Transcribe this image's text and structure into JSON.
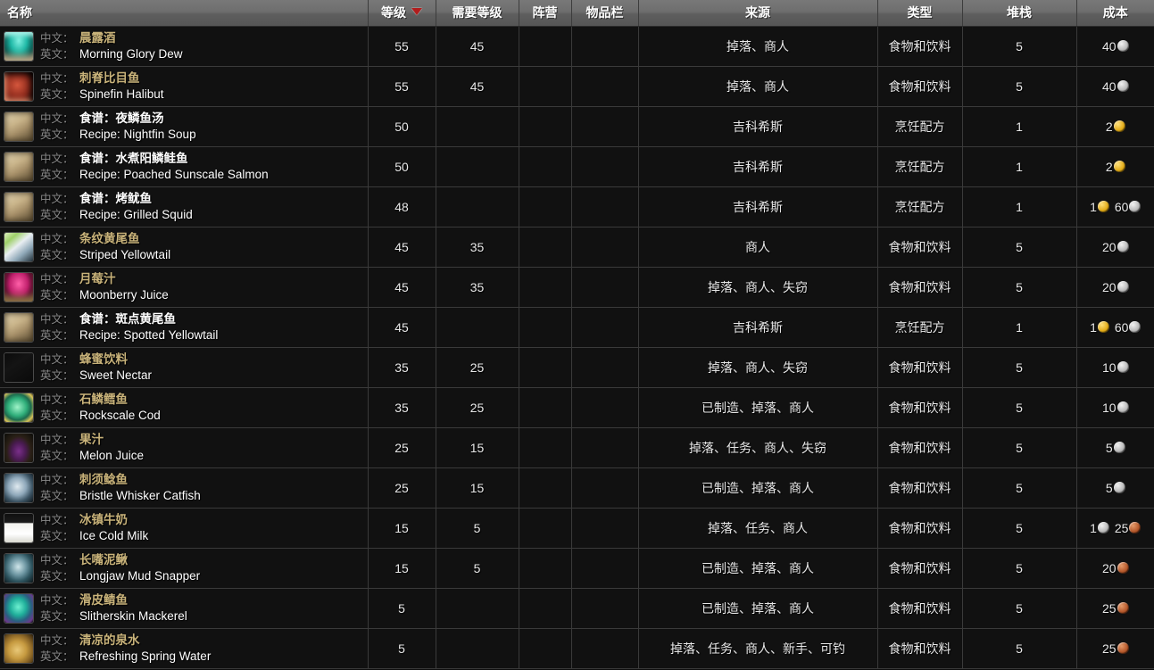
{
  "table": {
    "columns": [
      {
        "key": "name",
        "label": "名称",
        "align": "left",
        "sorted": false
      },
      {
        "key": "level",
        "label": "等级",
        "align": "center",
        "sorted": true
      },
      {
        "key": "reqlvl",
        "label": "需要等级",
        "align": "center",
        "sorted": false
      },
      {
        "key": "faction",
        "label": "阵营",
        "align": "center",
        "sorted": false
      },
      {
        "key": "slot",
        "label": "物品栏",
        "align": "center",
        "sorted": false
      },
      {
        "key": "source",
        "label": "来源",
        "align": "center",
        "sorted": false
      },
      {
        "key": "type",
        "label": "类型",
        "align": "center",
        "sorted": false
      },
      {
        "key": "stack",
        "label": "堆栈",
        "align": "center",
        "sorted": false
      },
      {
        "key": "cost",
        "label": "成本",
        "align": "center",
        "sorted": false
      }
    ],
    "labels": {
      "cn": "中文：",
      "en": "英文："
    },
    "rows": [
      {
        "icon": "potion-green-bowl-icon",
        "icon_kind": "drink-teal",
        "quality": "uncommon",
        "name_cn": "晨露酒",
        "name_en": "Morning Glory Dew",
        "level": "55",
        "reqlvl": "45",
        "faction": "",
        "slot": "",
        "source": "掉落、商人",
        "type": "食物和饮料",
        "stack": "5",
        "cost": [
          {
            "amount": "40",
            "coin": "silver"
          }
        ]
      },
      {
        "icon": "fish-red-icon",
        "icon_kind": "fish-red",
        "quality": "uncommon",
        "name_cn": "刺脊比目鱼",
        "name_en": "Spinefin Halibut",
        "level": "55",
        "reqlvl": "45",
        "faction": "",
        "slot": "",
        "source": "掉落、商人",
        "type": "食物和饮料",
        "stack": "5",
        "cost": [
          {
            "amount": "40",
            "coin": "silver"
          }
        ]
      },
      {
        "icon": "scroll-recipe-icon",
        "icon_kind": "scroll",
        "quality": "common",
        "name_cn": "食谱：夜鳞鱼汤",
        "name_en": "Recipe: Nightfin Soup",
        "level": "50",
        "reqlvl": "",
        "faction": "",
        "slot": "",
        "source": "吉科希斯",
        "type": "烹饪配方",
        "stack": "1",
        "cost": [
          {
            "amount": "2",
            "coin": "gold"
          }
        ]
      },
      {
        "icon": "scroll-recipe-icon",
        "icon_kind": "scroll",
        "quality": "common",
        "name_cn": "食谱：水煮阳鳞鲑鱼",
        "name_en": "Recipe: Poached Sunscale Salmon",
        "level": "50",
        "reqlvl": "",
        "faction": "",
        "slot": "",
        "source": "吉科希斯",
        "type": "烹饪配方",
        "stack": "1",
        "cost": [
          {
            "amount": "2",
            "coin": "gold"
          }
        ]
      },
      {
        "icon": "scroll-recipe-icon",
        "icon_kind": "scroll",
        "quality": "common",
        "name_cn": "食谱：烤鱿鱼",
        "name_en": "Recipe: Grilled Squid",
        "level": "48",
        "reqlvl": "",
        "faction": "",
        "slot": "",
        "source": "吉科希斯",
        "type": "烹饪配方",
        "stack": "1",
        "cost": [
          {
            "amount": "1",
            "coin": "gold"
          },
          {
            "amount": "60",
            "coin": "silver"
          }
        ]
      },
      {
        "icon": "fish-yellowtail-icon",
        "icon_kind": "fish-striped",
        "quality": "uncommon",
        "name_cn": "条纹黄尾鱼",
        "name_en": "Striped Yellowtail",
        "level": "45",
        "reqlvl": "35",
        "faction": "",
        "slot": "",
        "source": "商人",
        "type": "食物和饮料",
        "stack": "5",
        "cost": [
          {
            "amount": "20",
            "coin": "silver"
          }
        ]
      },
      {
        "icon": "juice-pink-icon",
        "icon_kind": "drink-pink",
        "quality": "uncommon",
        "name_cn": "月莓汁",
        "name_en": "Moonberry Juice",
        "level": "45",
        "reqlvl": "35",
        "faction": "",
        "slot": "",
        "source": "掉落、商人、失窃",
        "type": "食物和饮料",
        "stack": "5",
        "cost": [
          {
            "amount": "20",
            "coin": "silver"
          }
        ]
      },
      {
        "icon": "scroll-recipe-icon",
        "icon_kind": "scroll",
        "quality": "common",
        "name_cn": "食谱：斑点黄尾鱼",
        "name_en": "Recipe: Spotted Yellowtail",
        "level": "45",
        "reqlvl": "",
        "faction": "",
        "slot": "",
        "source": "吉科希斯",
        "type": "烹饪配方",
        "stack": "1",
        "cost": [
          {
            "amount": "1",
            "coin": "gold"
          },
          {
            "amount": "60",
            "coin": "silver"
          }
        ]
      },
      {
        "icon": "bottle-white-icon",
        "icon_kind": "bottle-white",
        "quality": "uncommon",
        "name_cn": "蜂蜜饮料",
        "name_en": "Sweet Nectar",
        "level": "35",
        "reqlvl": "25",
        "faction": "",
        "slot": "",
        "source": "掉落、商人、失窃",
        "type": "食物和饮料",
        "stack": "5",
        "cost": [
          {
            "amount": "10",
            "coin": "silver"
          }
        ]
      },
      {
        "icon": "fish-green-icon",
        "icon_kind": "fish-green",
        "quality": "uncommon",
        "name_cn": "石鳞鳕鱼",
        "name_en": "Rockscale Cod",
        "level": "35",
        "reqlvl": "25",
        "faction": "",
        "slot": "",
        "source": "已制造、掉落、商人",
        "type": "食物和饮料",
        "stack": "5",
        "cost": [
          {
            "amount": "10",
            "coin": "silver"
          }
        ]
      },
      {
        "icon": "flask-purple-icon",
        "icon_kind": "flask-purple",
        "quality": "uncommon",
        "name_cn": "果汁",
        "name_en": "Melon Juice",
        "level": "25",
        "reqlvl": "15",
        "faction": "",
        "slot": "",
        "source": "掉落、任务、商人、失窃",
        "type": "食物和饮料",
        "stack": "5",
        "cost": [
          {
            "amount": "5",
            "coin": "silver"
          }
        ]
      },
      {
        "icon": "fish-blue-icon",
        "icon_kind": "fish-blue",
        "quality": "uncommon",
        "name_cn": "刺须鲶鱼",
        "name_en": "Bristle Whisker Catfish",
        "level": "25",
        "reqlvl": "15",
        "faction": "",
        "slot": "",
        "source": "已制造、掉落、商人",
        "type": "食物和饮料",
        "stack": "5",
        "cost": [
          {
            "amount": "5",
            "coin": "silver"
          }
        ]
      },
      {
        "icon": "milk-glass-icon",
        "icon_kind": "milk",
        "quality": "uncommon",
        "name_cn": "冰镇牛奶",
        "name_en": "Ice Cold Milk",
        "level": "15",
        "reqlvl": "5",
        "faction": "",
        "slot": "",
        "source": "掉落、任务、商人",
        "type": "食物和饮料",
        "stack": "5",
        "cost": [
          {
            "amount": "1",
            "coin": "silver"
          },
          {
            "amount": "25",
            "coin": "copper"
          }
        ]
      },
      {
        "icon": "fish-snapper-icon",
        "icon_kind": "fish-snapper",
        "quality": "uncommon",
        "name_cn": "长嘴泥鳅",
        "name_en": "Longjaw Mud Snapper",
        "level": "15",
        "reqlvl": "5",
        "faction": "",
        "slot": "",
        "source": "已制造、掉落、商人",
        "type": "食物和饮料",
        "stack": "5",
        "cost": [
          {
            "amount": "20",
            "coin": "copper"
          }
        ]
      },
      {
        "icon": "fish-mackerel-icon",
        "icon_kind": "fish-mackerel",
        "quality": "uncommon",
        "name_cn": "滑皮鲭鱼",
        "name_en": "Slitherskin Mackerel",
        "level": "5",
        "reqlvl": "",
        "faction": "",
        "slot": "",
        "source": "已制造、掉落、商人",
        "type": "食物和饮料",
        "stack": "5",
        "cost": [
          {
            "amount": "25",
            "coin": "copper"
          }
        ]
      },
      {
        "icon": "waterskin-icon",
        "icon_kind": "waterskin",
        "quality": "uncommon",
        "name_cn": "清凉的泉水",
        "name_en": "Refreshing Spring Water",
        "level": "5",
        "reqlvl": "",
        "faction": "",
        "slot": "",
        "source": "掉落、任务、商人、新手、可钓",
        "type": "食物和饮料",
        "stack": "5",
        "cost": [
          {
            "amount": "25",
            "coin": "copper"
          }
        ]
      }
    ]
  },
  "colors": {
    "header_bg": "#6e6e6e",
    "row_bg": "#111111",
    "grid": "#3a3a3a",
    "quality_uncommon": "#c9b37a",
    "quality_common": "#ffffff",
    "sort_caret": "#b11d1d",
    "gold": "#e3ac18",
    "silver": "#b9b9b9",
    "copper": "#b4572a"
  }
}
